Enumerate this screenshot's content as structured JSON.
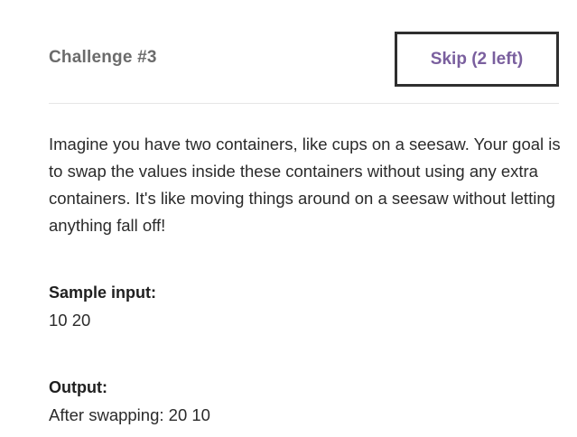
{
  "challenge": {
    "title": "Challenge #3",
    "skip_label": "Skip (2 left)",
    "description": "Imagine you have two containers, like cups on a seesaw. Your goal is to swap the values inside these containers without using any extra containers. It's like moving things around on a seesaw without letting anything fall off!",
    "sample_input_label": "Sample input:",
    "sample_input_value": "10 20",
    "output_label": "Output:",
    "output_value": "After swapping: 20 10"
  },
  "colors": {
    "title": "#6b6b6b",
    "skip_text": "#7a5f9e",
    "skip_border": "#2f2f2f",
    "divider": "#e6e6e6",
    "body_text": "#2b2b2b"
  }
}
